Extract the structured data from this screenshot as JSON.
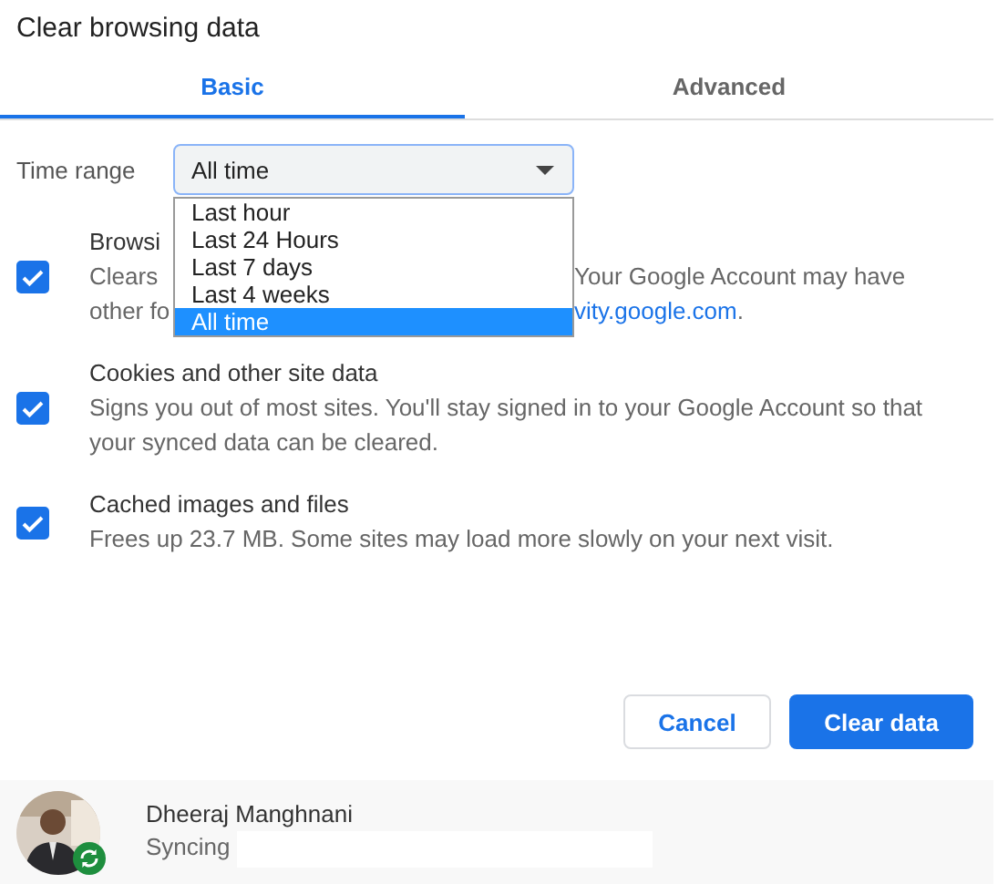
{
  "dialog": {
    "title": "Clear browsing data"
  },
  "tabs": [
    {
      "label": "Basic",
      "selected": true
    },
    {
      "label": "Advanced",
      "selected": false
    }
  ],
  "time_range": {
    "label": "Time range",
    "value": "All time",
    "options": [
      {
        "label": "Last hour",
        "selected": false
      },
      {
        "label": "Last 24 Hours",
        "selected": false
      },
      {
        "label": "Last 7 days",
        "selected": false
      },
      {
        "label": "Last 4 weeks",
        "selected": false
      },
      {
        "label": "All time",
        "selected": true
      }
    ]
  },
  "items": [
    {
      "title": "Browsi",
      "checked": true,
      "line_1_start": "Clears",
      "line_1_end": "Your Google Account may have",
      "line_2_start": "other fo",
      "line_2_link": "vity.google.com",
      "line_2_end": "."
    },
    {
      "title": "Cookies and other site data",
      "checked": true,
      "description": "Signs you out of most sites. You'll stay signed in to your Google Account so that your synced data can be cleared."
    },
    {
      "title": "Cached images and files",
      "checked": true,
      "description": "Frees up 23.7 MB. Some sites may load more slowly on your next visit."
    }
  ],
  "buttons": {
    "cancel": "Cancel",
    "confirm": "Clear data"
  },
  "account": {
    "name": "Dheeraj Manghnani",
    "status": "Syncing"
  }
}
